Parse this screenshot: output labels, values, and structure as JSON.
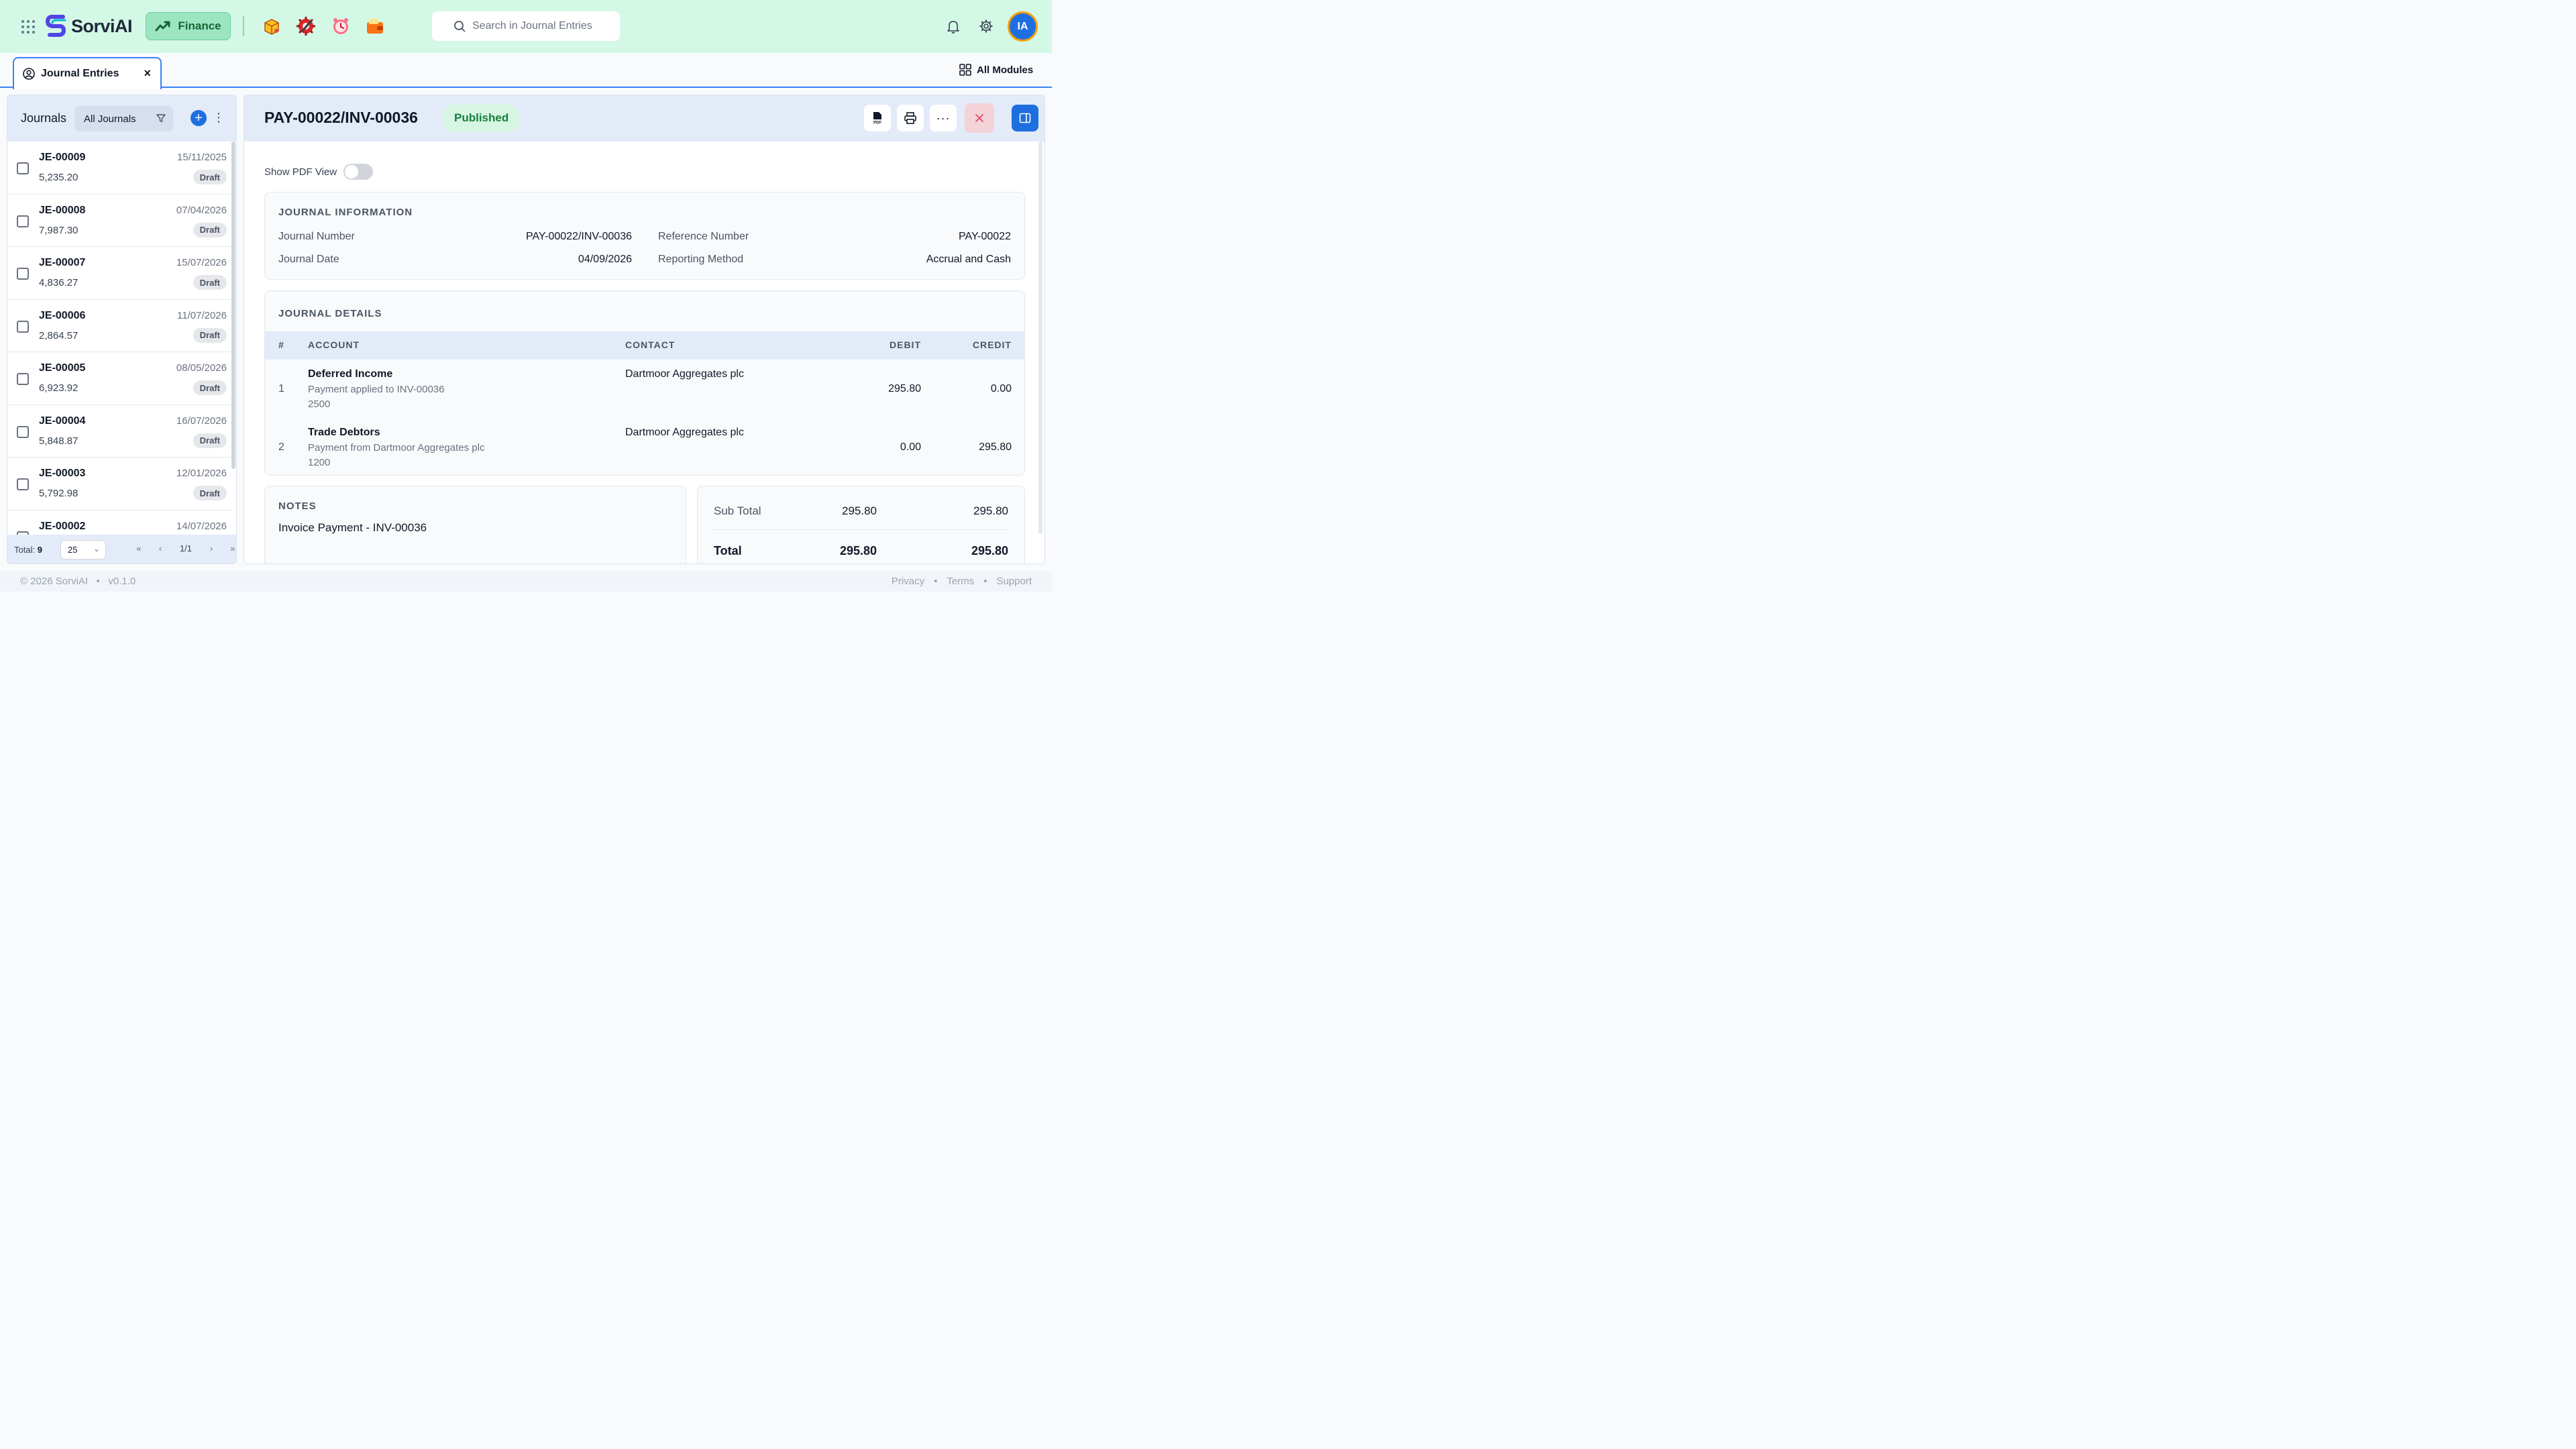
{
  "app": {
    "brand": "SorviAI",
    "module_button": "Finance",
    "search_placeholder": "Search in Journal Entries",
    "user_initials": "IA",
    "all_modules": "All Modules"
  },
  "tab": {
    "label": "Journal Entries",
    "close": "×"
  },
  "journals_panel": {
    "title": "Journals",
    "filter": "All Journals",
    "add": "+",
    "more": "⋮",
    "items": [
      {
        "id": "JE-00009",
        "amount": "5,235.20",
        "date": "15/11/2025",
        "status": "Draft"
      },
      {
        "id": "JE-00008",
        "amount": "7,987.30",
        "date": "07/04/2026",
        "status": "Draft"
      },
      {
        "id": "JE-00007",
        "amount": "4,836.27",
        "date": "15/07/2026",
        "status": "Draft"
      },
      {
        "id": "JE-00006",
        "amount": "2,864.57",
        "date": "11/07/2026",
        "status": "Draft"
      },
      {
        "id": "JE-00005",
        "amount": "6,923.92",
        "date": "08/05/2026",
        "status": "Draft"
      },
      {
        "id": "JE-00004",
        "amount": "5,848.87",
        "date": "16/07/2026",
        "status": "Draft"
      },
      {
        "id": "JE-00003",
        "amount": "5,792.98",
        "date": "12/01/2026",
        "status": "Draft"
      },
      {
        "id": "JE-00002",
        "amount": "",
        "date": "14/07/2026",
        "status": ""
      }
    ],
    "footer": {
      "total_label": "Total:",
      "total_value": "9",
      "page_size": "25",
      "page": "1/1"
    }
  },
  "detail": {
    "title": "PAY-00022/INV-00036",
    "status": "Published",
    "show_pdf_label": "Show PDF View",
    "info": {
      "section_title": "JOURNAL INFORMATION",
      "journal_number_label": "Journal Number",
      "journal_number": "PAY-00022/INV-00036",
      "journal_date_label": "Journal Date",
      "journal_date": "04/09/2026",
      "reference_label": "Reference Number",
      "reference": "PAY-00022",
      "reporting_label": "Reporting Method",
      "reporting": "Accrual and Cash"
    },
    "details": {
      "section_title": "JOURNAL DETAILS",
      "columns": {
        "num": "#",
        "account": "ACCOUNT",
        "contact": "CONTACT",
        "debit": "DEBIT",
        "credit": "CREDIT"
      },
      "rows": [
        {
          "num": "1",
          "account": "Deferred Income",
          "desc": "Payment applied to INV-00036",
          "code": "2500",
          "contact": "Dartmoor Aggregates plc",
          "debit": "295.80",
          "credit": "0.00"
        },
        {
          "num": "2",
          "account": "Trade Debtors",
          "desc": "Payment from Dartmoor Aggregates plc",
          "code": "1200",
          "contact": "Dartmoor Aggregates plc",
          "debit": "0.00",
          "credit": "295.80"
        }
      ]
    },
    "notes": {
      "title": "NOTES",
      "text": "Invoice Payment - INV-00036"
    },
    "totals": {
      "subtotal_label": "Sub Total",
      "subtotal_debit": "295.80",
      "subtotal_credit": "295.80",
      "total_label": "Total",
      "total_debit": "295.80",
      "total_credit": "295.80"
    }
  },
  "footer": {
    "copyright": "© 2026 SorviAI",
    "version": "v0.1.0",
    "links": [
      "Privacy",
      "Terms",
      "Support"
    ]
  }
}
